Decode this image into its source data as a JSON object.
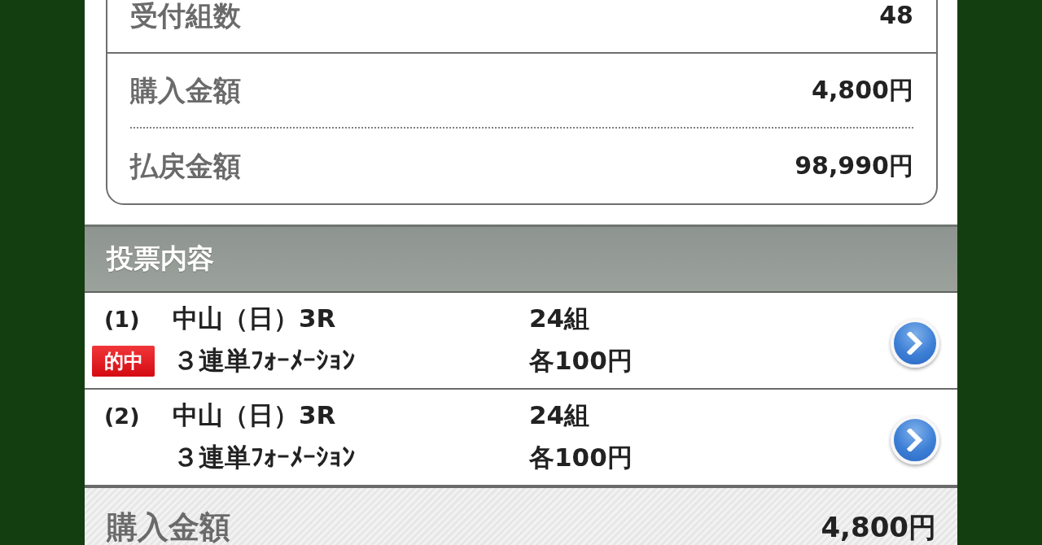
{
  "summary": [
    {
      "label": "受付組数",
      "value": "48"
    },
    {
      "label": "購入金額",
      "value": "4,800円"
    },
    {
      "label": "払戻金額",
      "value": "98,990円"
    }
  ],
  "section": {
    "title": "投票内容"
  },
  "bets": [
    {
      "number": "(1)",
      "hit": true,
      "badge": "的中",
      "venue": "中山（日）3R",
      "bet_type": "３連単ﾌｫｰﾒｰｼｮﾝ",
      "combinations": "24組",
      "unit_price": "各100円"
    },
    {
      "number": "(2)",
      "hit": false,
      "venue": "中山（日）3R",
      "bet_type": "３連単ﾌｫｰﾒｰｼｮﾝ",
      "combinations": "24組",
      "unit_price": "各100円"
    }
  ],
  "footer": {
    "label": "購入金額",
    "value": "4,800円"
  }
}
